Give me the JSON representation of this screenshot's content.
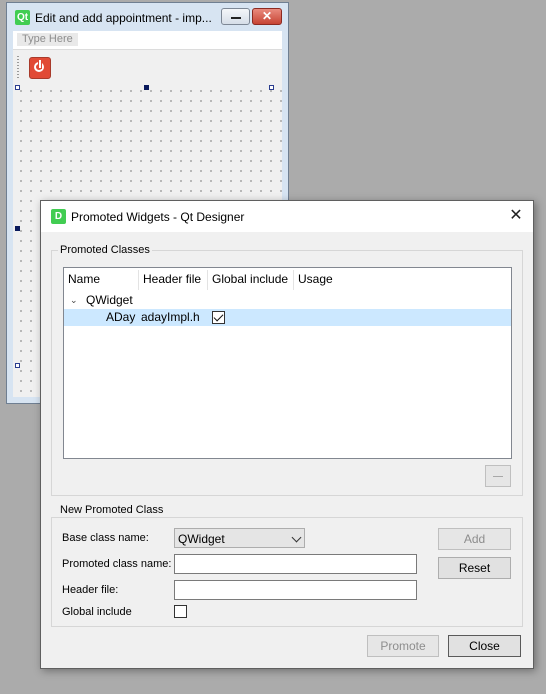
{
  "background_window": {
    "logo": "Qt",
    "title": "Edit and add appointment - imp...",
    "close_glyph": "✕",
    "menubar_placeholder": "Type Here",
    "toolbar_action_icon": "power-icon"
  },
  "dialog": {
    "logo": "D",
    "title": "Promoted Widgets - Qt Designer",
    "close_glyph": "✕",
    "promoted_classes": {
      "group_title": "Promoted Classes",
      "columns": [
        "Name",
        "Header file",
        "Global include",
        "Usage"
      ],
      "parent_item": "QWidget",
      "expand_glyph": "⌄",
      "child_row": {
        "name": "ADay",
        "header_file": "adayImpl.h",
        "global_include": true,
        "usage": ""
      }
    },
    "new_promoted_class": {
      "group_title": "New Promoted Class",
      "base_class_label": "Base class name:",
      "base_class_value": "QWidget",
      "promoted_class_label": "Promoted class name:",
      "promoted_class_value": "",
      "header_file_label": "Header file:",
      "header_file_value": "",
      "global_include_label": "Global include",
      "global_include_checked": false,
      "add_label": "Add",
      "reset_label": "Reset"
    },
    "promote_label": "Promote",
    "close_label": "Close"
  },
  "colors": {
    "desktop": "#ababab",
    "selection": "#cce8ff",
    "qt_green": "#41cd52",
    "close_red": "#c74434"
  }
}
